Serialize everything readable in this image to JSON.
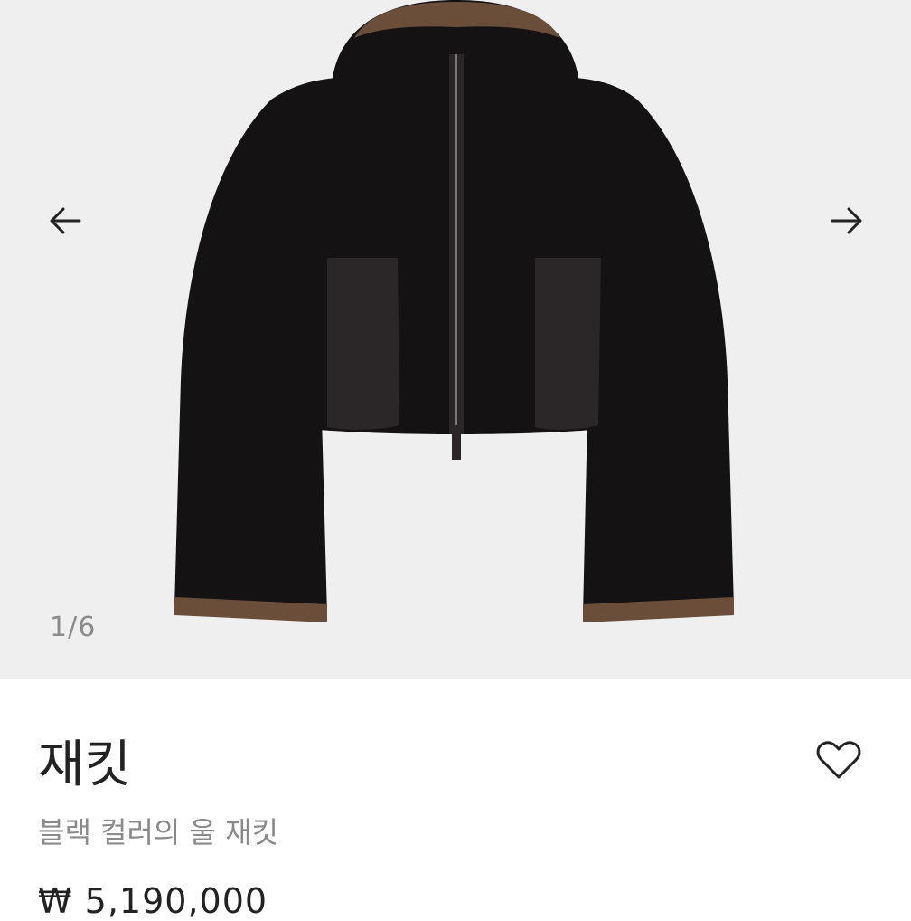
{
  "gallery": {
    "counter": "1/6",
    "prev_icon": "arrow-left-icon",
    "next_icon": "arrow-right-icon",
    "image_subject": "black-hooded-jacket"
  },
  "product": {
    "title": "재킷",
    "subtitle": "블랙 컬러의 울 재킷",
    "price": "₩ 5,190,000",
    "wishlist_icon": "heart-outline-icon"
  },
  "colors": {
    "image_background": "#efefef",
    "jacket": "#151214",
    "lining_brown": "#6b4e3a",
    "muted_text": "#8a8a8a"
  }
}
